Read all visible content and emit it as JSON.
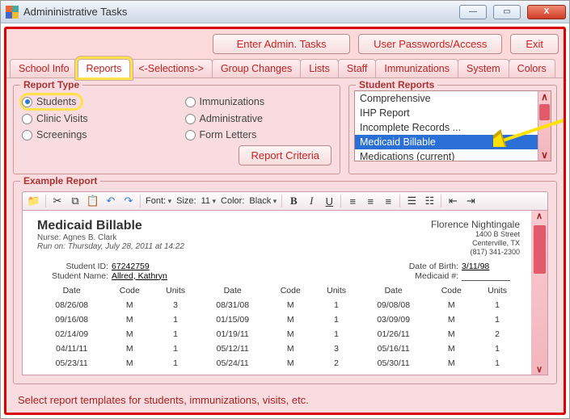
{
  "window": {
    "title": "Admininistrative Tasks"
  },
  "topButtons": {
    "enterAdmin": "Enter Admin. Tasks",
    "passwords": "User Passwords/Access",
    "exit": "Exit"
  },
  "tabs": [
    "School Info",
    "Reports",
    "<-Selections->",
    "Group Changes",
    "Lists",
    "Staff",
    "Immunizations",
    "System",
    "Colors"
  ],
  "activeTab": "Reports",
  "reportType": {
    "legend": "Report Type",
    "options": [
      "Students",
      "Immunizations",
      "Clinic Visits",
      "Administrative",
      "Screenings",
      "Form Letters"
    ],
    "selected": "Students",
    "criteriaBtn": "Report Criteria"
  },
  "studentReports": {
    "legend": "Student Reports",
    "items": [
      "Comprehensive",
      "IHP Report",
      "Incomplete Records ...",
      "Medicaid Billable",
      "Medications (current)"
    ],
    "selected": "Medicaid Billable"
  },
  "exampleReport": {
    "legend": "Example Report",
    "toolbar": {
      "font": "Font:",
      "size": "Size:",
      "sizeVal": "11",
      "color": "Color:",
      "colorVal": "Black"
    },
    "report": {
      "title": "Medicaid Billable",
      "nurseLabel": "Nurse:",
      "nurse": "Agnes B. Clark",
      "runOn": "Run on: Thursday, July 28, 2011 at 14:22",
      "org": {
        "name": "Florence Nightingale",
        "street": "1400 B Street",
        "cityzip": "Centerville, TX",
        "phone": "(817) 341-2300"
      },
      "studentIdLabel": "Student ID:",
      "studentId": "67242759",
      "studentNameLabel": "Student Name:",
      "studentName": "Allred, Kathryn",
      "dobLabel": "Date of Birth:",
      "dob": "3/11/98",
      "medicaidLabel": "Medicaid #:",
      "medicaid": "",
      "columns": [
        "Date",
        "Code",
        "Units",
        "Date",
        "Code",
        "Units",
        "Date",
        "Code",
        "Units"
      ],
      "rows": [
        [
          "08/26/08",
          "M",
          "3",
          "08/31/08",
          "M",
          "1",
          "09/08/08",
          "M",
          "1"
        ],
        [
          "09/16/08",
          "M",
          "1",
          "01/15/09",
          "M",
          "1",
          "03/09/09",
          "M",
          "1"
        ],
        [
          "02/14/09",
          "M",
          "1",
          "01/19/11",
          "M",
          "1",
          "01/26/11",
          "M",
          "2"
        ],
        [
          "04/11/11",
          "M",
          "1",
          "05/12/11",
          "M",
          "3",
          "05/16/11",
          "M",
          "1"
        ],
        [
          "05/23/11",
          "M",
          "1",
          "05/24/11",
          "M",
          "2",
          "05/30/11",
          "M",
          "1"
        ]
      ]
    }
  },
  "status": "Select report templates for students, immunizations, visits, etc."
}
